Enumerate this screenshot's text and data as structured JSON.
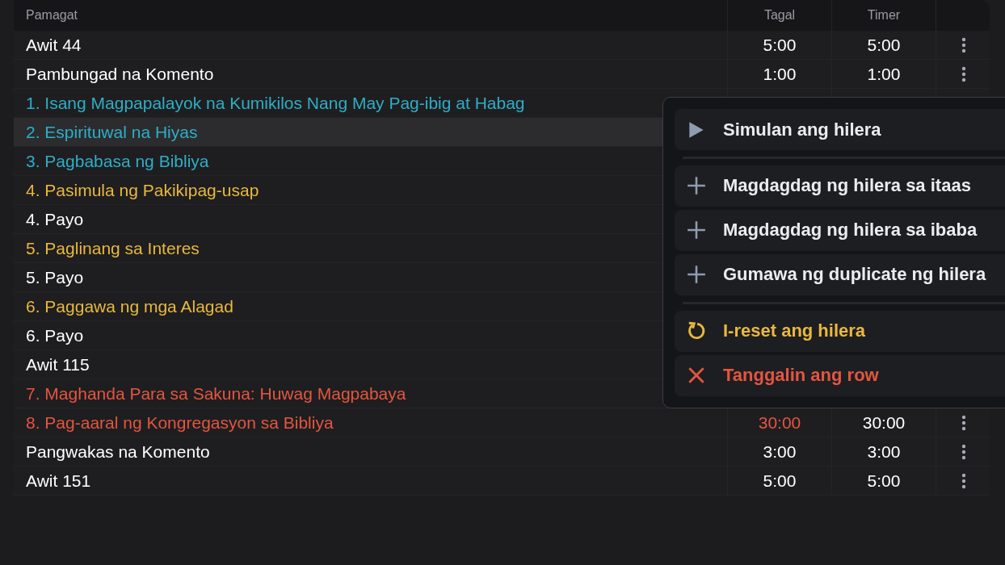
{
  "table": {
    "columns": [
      "Pamagat",
      "Tagal",
      "Timer"
    ],
    "rows": [
      {
        "title": "Awit 44",
        "tagal": "5:00",
        "timer": "5:00",
        "color": "#ffffff",
        "hovered": false,
        "over": false
      },
      {
        "title": "Pambungad na Komento",
        "tagal": "1:00",
        "timer": "1:00",
        "color": "#ffffff",
        "hovered": false,
        "over": false
      },
      {
        "title": "1. Isang Magpapalayok na Kumikilos Nang May Pag-ibig at Habag",
        "color": "#2eaec6",
        "hovered": false
      },
      {
        "title": "2. Espirituwal na Hiyas",
        "color": "#2eaec6",
        "hovered": true
      },
      {
        "title": "3. Pagbabasa ng Bibliya",
        "color": "#2eaec6",
        "hovered": false
      },
      {
        "title": "4. Pasimula ng Pakikipag-usap",
        "color": "#e9b83c",
        "hovered": false
      },
      {
        "title": "4. Payo",
        "color": "#ffffff",
        "hovered": false
      },
      {
        "title": "5. Paglinang sa Interes",
        "color": "#e9b83c",
        "hovered": false
      },
      {
        "title": "5. Payo",
        "color": "#ffffff",
        "hovered": false
      },
      {
        "title": "6. Paggawa ng mga Alagad",
        "color": "#e9b83c",
        "hovered": false
      },
      {
        "title": "6. Payo",
        "color": "#ffffff",
        "hovered": false
      },
      {
        "title": "Awit 115",
        "color": "#ffffff",
        "hovered": false
      },
      {
        "title": "7. Maghanda Para sa Sakuna: Huwag Magpabaya",
        "color": "#e5553f",
        "hovered": false
      },
      {
        "title": "8. Pag-aaral ng Kongregasyon sa Bibliya",
        "tagal": "30:00",
        "timer": "30:00",
        "color": "#e5553f",
        "hovered": false,
        "over": true
      },
      {
        "title": "Pangwakas na Komento",
        "tagal": "3:00",
        "timer": "3:00",
        "color": "#ffffff",
        "hovered": false,
        "over": false
      },
      {
        "title": "Awit 151",
        "tagal": "5:00",
        "timer": "5:00",
        "color": "#ffffff",
        "hovered": false,
        "over": false
      }
    ]
  },
  "context_menu": {
    "groups": [
      [
        {
          "kind": "play",
          "label": "Simulan ang hilera"
        }
      ],
      [
        {
          "kind": "add",
          "label": "Magdagdag ng hilera sa itaas"
        },
        {
          "kind": "add",
          "label": "Magdagdag ng hilera sa ibaba"
        },
        {
          "kind": "add",
          "label": "Gumawa ng duplicate ng hilera"
        }
      ],
      [
        {
          "kind": "reset",
          "label": "I-reset ang hilera"
        },
        {
          "kind": "delete",
          "label": "Tanggalin ang row"
        }
      ]
    ]
  }
}
